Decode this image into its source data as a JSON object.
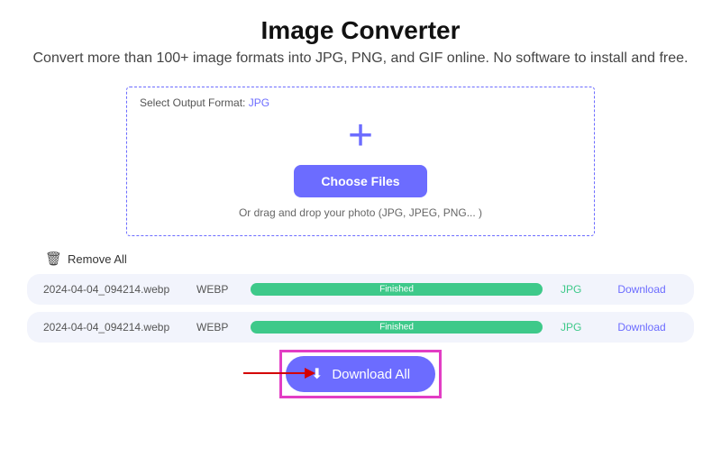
{
  "header": {
    "title": "Image Converter",
    "subtitle": "Convert more than 100+ image formats into JPG, PNG, and GIF online. No software to install and free."
  },
  "dropzone": {
    "format_label": "Select Output Format:",
    "format_value": "JPG",
    "choose_label": "Choose Files",
    "drag_hint": "Or drag and drop your photo (JPG, JPEG, PNG... )"
  },
  "actions": {
    "remove_all": "Remove All",
    "download_all": "Download All"
  },
  "files": [
    {
      "name": "2024-04-04_094214.webp",
      "source_format": "WEBP",
      "status": "Finished",
      "target_format": "JPG",
      "download_label": "Download"
    },
    {
      "name": "2024-04-04_094214.webp",
      "source_format": "WEBP",
      "status": "Finished",
      "target_format": "JPG",
      "download_label": "Download"
    }
  ]
}
